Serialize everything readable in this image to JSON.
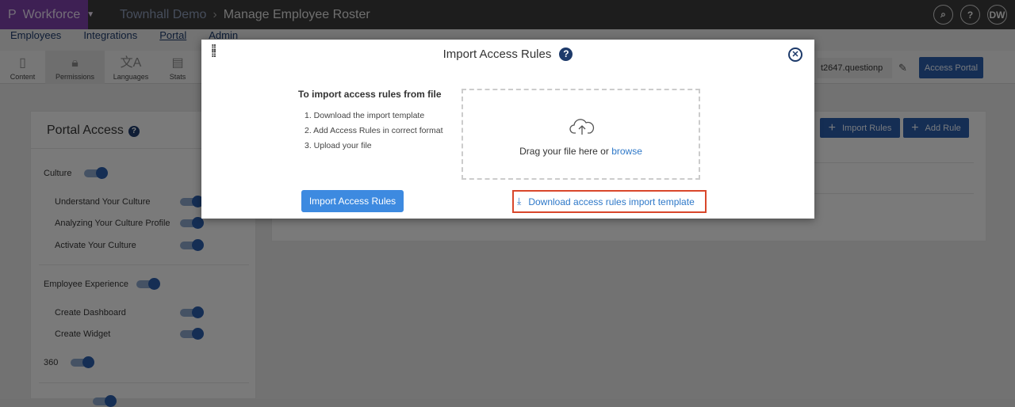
{
  "topbar": {
    "app": "Workforce",
    "breadcrumb": [
      "Townhall Demo",
      "Manage Employee Roster"
    ],
    "icons": [
      "search-icon",
      "help-icon"
    ],
    "avatar": "DW"
  },
  "nav": [
    "Employees",
    "Integrations",
    "Portal",
    "Admin"
  ],
  "toolbar": [
    "Content",
    "Permissions",
    "Languages",
    "Stats"
  ],
  "portal_url": "t2647.questionp",
  "access_portal": "Access Portal",
  "import_rules": "Import Rules",
  "add_rule": "Add Rule",
  "portal_access": {
    "title": "Portal Access",
    "items": [
      "Culture",
      "Understand Your Culture",
      "Analyzing Your Culture Profile",
      "Activate Your Culture",
      "Employee Experience",
      "Create Dashboard",
      "Create Widget",
      "360"
    ],
    "toggles_on": true
  },
  "modal": {
    "title": "Import Access Rules",
    "heading": "To import access rules from file",
    "steps": [
      "1. Download the import template",
      "2. Add Access Rules in correct format",
      "3. Upload your file"
    ],
    "drop_text": "Drag your file here or",
    "browse": "browse",
    "button": "Import Access Rules",
    "download": "Download access rules import template"
  },
  "colors": {
    "brand": "#7b3fa8",
    "primary": "#3d8ae0",
    "highlight": "#d9472b"
  }
}
